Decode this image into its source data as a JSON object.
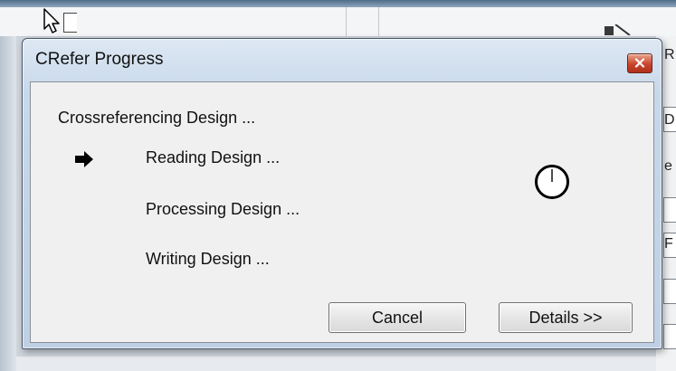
{
  "dialog": {
    "title": "CRefer Progress",
    "heading": "Crossreferencing Design ...",
    "steps": [
      {
        "label": "Reading Design ...",
        "current": true
      },
      {
        "label": "Processing Design ...",
        "current": false
      },
      {
        "label": "Writing Design ...",
        "current": false
      }
    ],
    "buttons": {
      "cancel": "Cancel",
      "details": "Details >>"
    },
    "icons": {
      "current_step": "arrow-right-icon",
      "busy": "clock-icon",
      "close": "close-icon"
    }
  },
  "background": {
    "right_edge_letters": [
      "R",
      "D",
      "e",
      "F"
    ]
  },
  "colors": {
    "close_button": "#c9452b",
    "dialog_frame": "#c8d8ea",
    "client_area": "#f0f0f0"
  }
}
